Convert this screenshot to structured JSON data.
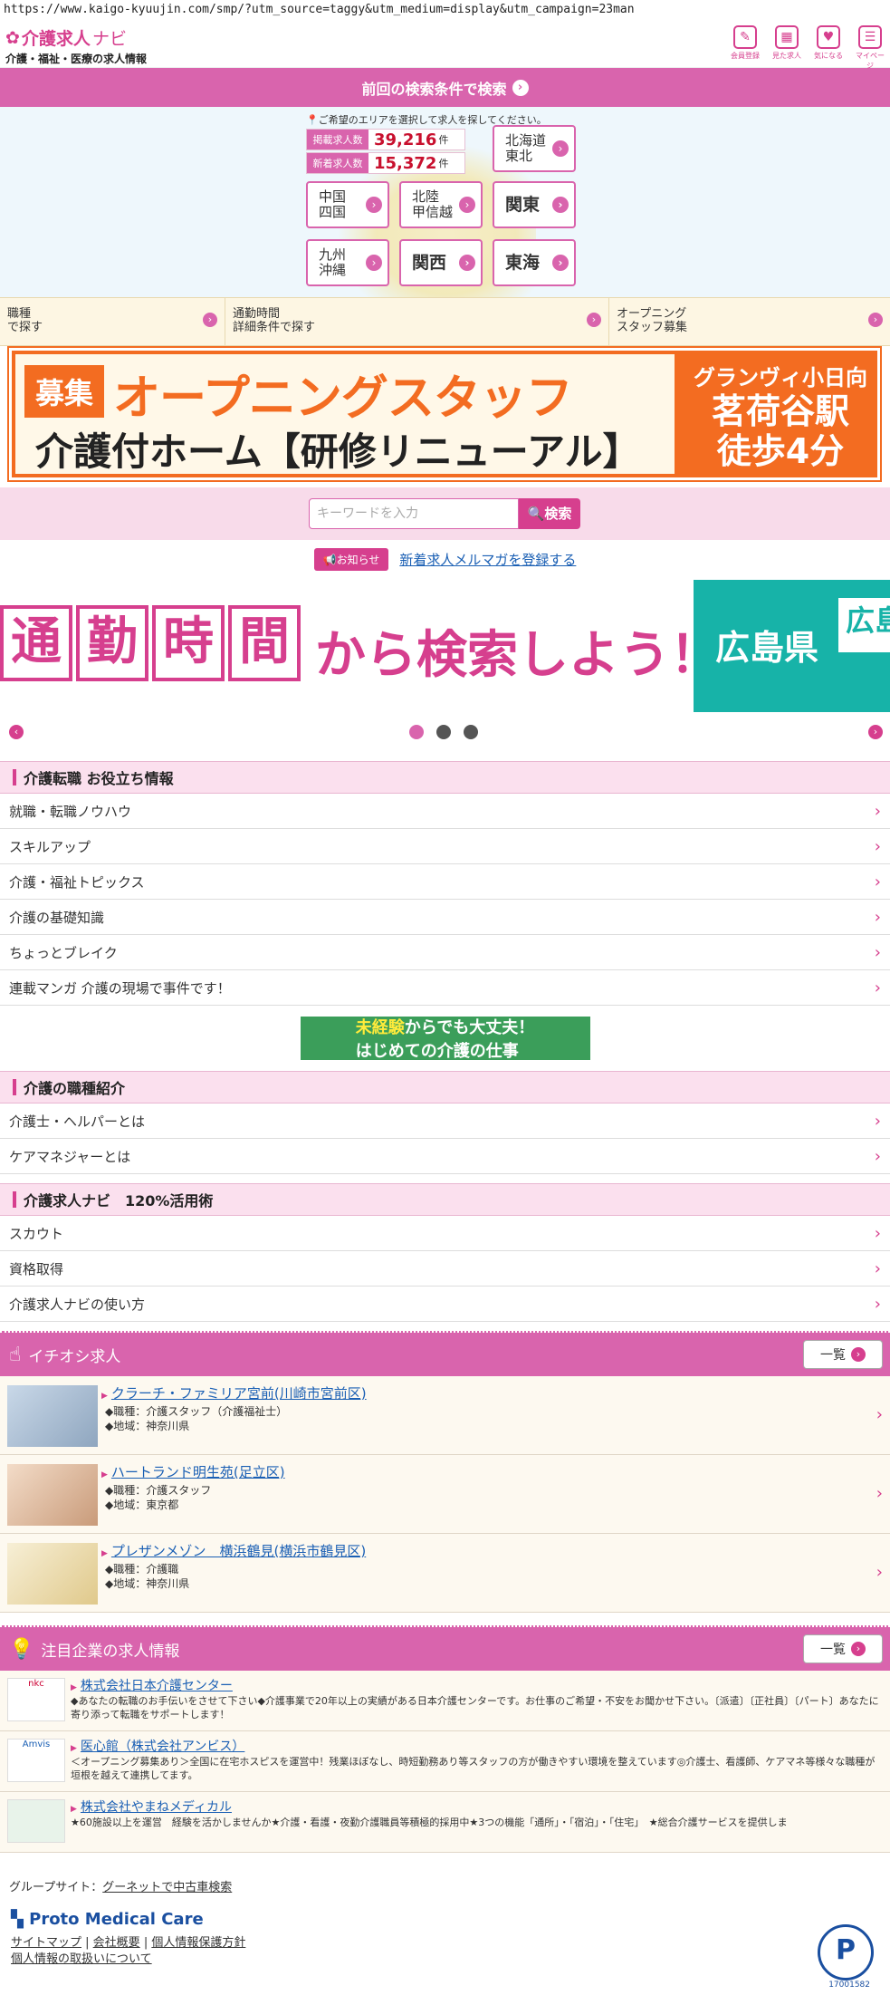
{
  "url": "https://www.kaigo-kyuujin.com/smp/?utm_source=taggy&utm_medium=display&utm_campaign=23man",
  "header": {
    "brand": "介護求人",
    "brand_navi": "ナビ",
    "subtitle": "介護・福祉・医療の求人情報",
    "nav": [
      {
        "label": "会員登録",
        "icon": "pencil-icon"
      },
      {
        "label": "見た求人",
        "icon": "calendar-icon"
      },
      {
        "label": "気になる",
        "icon": "heart-icon"
      },
      {
        "label": "マイページ",
        "icon": "book-icon"
      }
    ]
  },
  "prev_search": "前回の検索条件で検索",
  "area": {
    "hint": "ご希望のエリアを選択して求人を探してください。",
    "counts": [
      {
        "label": "掲載求人数",
        "value": "39,216",
        "unit": "件"
      },
      {
        "label": "新着求人数",
        "value": "15,372",
        "unit": "件"
      }
    ],
    "regions": [
      "北海道\n東北",
      "中国\n四国",
      "北陸\n甲信越",
      "関東",
      "九州\n沖縄",
      "関西",
      "東海"
    ]
  },
  "quick": [
    {
      "label": "職種\nで探す"
    },
    {
      "label": "通勤時間\n詳細条件で探す"
    },
    {
      "label": "オープニング\nスタッフ募集"
    }
  ],
  "banner1": {
    "tag": "募集",
    "title": "オープニングスタッフ",
    "subtitle": "介護付ホーム【研修リニューアル】",
    "side1": "グランヴィ小日向",
    "side2": "茗荷谷駅",
    "side3": "徒歩4分"
  },
  "search": {
    "placeholder": "キーワードを入力",
    "button": "検索"
  },
  "notice": {
    "tag": "お知らせ",
    "link": "新着求人メルマガを登録する"
  },
  "banner2": {
    "chars": [
      "通",
      "勤",
      "時",
      "間"
    ],
    "rest": "から検索しよう！ ▶",
    "side": "広島県",
    "side2": "広島"
  },
  "sections": [
    {
      "title": "介護転職 お役立ち情報",
      "items": [
        "就職・転職ノウハウ",
        "スキルアップ",
        "介護・福祉トピックス",
        "介護の基礎知識",
        "ちょっとブレイク",
        "連載マンガ 介護の現場で事件です！"
      ]
    },
    {
      "title": "介護の職種紹介",
      "items": [
        "介護士・ヘルパーとは",
        "ケアマネジャーとは"
      ]
    },
    {
      "title": "介護求人ナビ　120%活用術",
      "items": [
        "スカウト",
        "資格取得",
        "介護求人ナビの使い方"
      ]
    }
  ],
  "mikei": {
    "y": "未経験",
    "rest": "からでも大丈夫！",
    "line2": "はじめての介護の仕事"
  },
  "recommend": {
    "title": "イチオシ求人",
    "more": "一覧",
    "jobs": [
      {
        "title": "クラーチ・ファミリア宮前(川崎市宮前区)",
        "type": "◆職種：介護スタッフ（介護福祉士）",
        "area": "◆地域：神奈川県"
      },
      {
        "title": "ハートランド明生苑(足立区)",
        "type": "◆職種：介護スタッフ",
        "area": "◆地域：東京都"
      },
      {
        "title": "プレザンメゾン　横浜鶴見(横浜市鶴見区)",
        "type": "◆職種：介護職",
        "area": "◆地域：神奈川県"
      }
    ]
  },
  "companies": {
    "title": "注目企業の求人情報",
    "more": "一覧",
    "items": [
      {
        "name": "株式会社日本介護センター",
        "logo": "nkc",
        "desc": "◆あなたの転職のお手伝いをさせて下さい◆介護事業で20年以上の実績がある日本介護センターです。お仕事のご希望・不安をお聞かせ下さい。〔派遣〕〔正社員〕〔パート〕あなたに寄り添って転職をサポートします！"
      },
      {
        "name": "医心館（株式会社アンビス）",
        "logo": "Amvis",
        "desc": "＜オープニング募集あり＞全国に在宅ホスピスを運営中！残業ほぼなし、時短勤務あり等スタッフの方が働きやすい環境を整えています◎介護士、看護師、ケアマネ等様々な職種が垣根を越えて連携してます。"
      },
      {
        "name": "株式会社やまねメディカル",
        "logo": "",
        "desc": "★60施設以上を運営　経験を活かしませんか★介護・看護・夜勤介護職員等積極的採用中★3つの機能「通所」・「宿泊」・「住宅」　★総合介護サービスを提供しま"
      }
    ]
  },
  "footer": {
    "group_label": "グループサイト：",
    "group_link": "グーネットで中古車検索",
    "brand": "Proto Medical Care",
    "links": [
      "サイトマップ",
      "会社概要",
      "個人情報保護方針",
      "個人情報の取扱いについて"
    ],
    "pmark_num": "17001582"
  },
  "colors": {
    "accent": "#d63f8e",
    "accent_light": "#d964ad",
    "orange": "#f36c21",
    "teal": "#17b3a8"
  }
}
